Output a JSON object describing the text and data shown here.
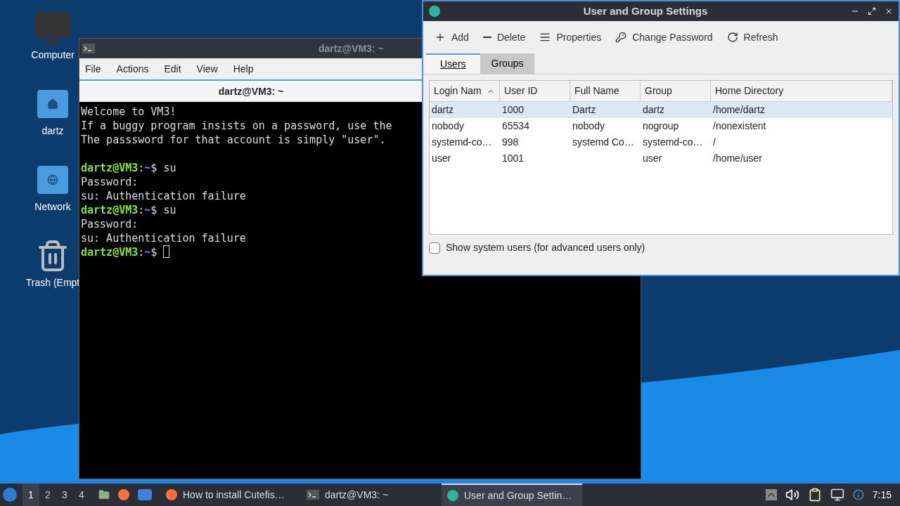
{
  "desktop_icons": [
    {
      "kind": "computer",
      "label": "Computer"
    },
    {
      "kind": "home",
      "label": "dartz"
    },
    {
      "kind": "network",
      "label": "Network"
    },
    {
      "kind": "trash",
      "label": "Trash (Empt"
    }
  ],
  "terminal": {
    "window_title": "dartz@VM3: ~",
    "menu": [
      "File",
      "Actions",
      "Edit",
      "View",
      "Help"
    ],
    "tab_title": "dartz@VM3: ~",
    "lines": [
      {
        "kind": "text",
        "text": "Welcome to VM3!"
      },
      {
        "kind": "text",
        "text": "If a buggy program insists on a password, use the"
      },
      {
        "kind": "text",
        "text": "The passsword for that account is simply \"user\"."
      },
      {
        "kind": "blank"
      },
      {
        "kind": "prompt",
        "user_host": "dartz@VM3",
        "separator": ":",
        "path": "~",
        "sign": "$",
        "command": "su"
      },
      {
        "kind": "text",
        "text": "Password:"
      },
      {
        "kind": "text",
        "text": "su: Authentication failure"
      },
      {
        "kind": "prompt",
        "user_host": "dartz@VM3",
        "separator": ":",
        "path": "~",
        "sign": "$",
        "command": "su"
      },
      {
        "kind": "text",
        "text": "Password:"
      },
      {
        "kind": "text",
        "text": "su: Authentication failure"
      },
      {
        "kind": "prompt",
        "user_host": "dartz@VM3",
        "separator": ":",
        "path": "~",
        "sign": "$",
        "cursor": true
      }
    ]
  },
  "settings": {
    "window_title": "User and Group Settings",
    "toolbar": [
      {
        "kind": "add",
        "label": "Add"
      },
      {
        "kind": "delete",
        "label": "Delete"
      },
      {
        "kind": "properties",
        "label": "Properties"
      },
      {
        "kind": "password",
        "label": "Change Password"
      },
      {
        "kind": "refresh",
        "label": "Refresh"
      }
    ],
    "tabs": [
      {
        "label": "Users",
        "selected": true
      },
      {
        "label": "Groups",
        "selected": false
      }
    ],
    "columns": [
      {
        "label": "Login Nam",
        "sorted": true
      },
      {
        "label": "User ID",
        "sorted": false
      },
      {
        "label": "Full Name",
        "sorted": false
      },
      {
        "label": "Group",
        "sorted": false
      },
      {
        "label": "Home Directory",
        "sorted": false
      }
    ],
    "rows": [
      {
        "cells": [
          "dartz",
          "1000",
          "Dartz",
          "dartz",
          "/home/dartz"
        ],
        "selected": true
      },
      {
        "cells": [
          "nobody",
          "65534",
          "nobody",
          "nogroup",
          "/nonexistent"
        ],
        "selected": false
      },
      {
        "cells": [
          "systemd-co…",
          "998",
          "systemd Co…",
          "systemd-co…",
          "/"
        ],
        "selected": false
      },
      {
        "cells": [
          "user",
          "1001",
          "",
          "user",
          "/home/user"
        ],
        "selected": false
      }
    ],
    "show_system_users": {
      "label": "Show system users (for advanced users only)",
      "checked": false
    }
  },
  "taskbar": {
    "workspaces": [
      {
        "label": "1",
        "selected": true
      },
      {
        "label": "2",
        "selected": false
      },
      {
        "label": "3",
        "selected": false
      },
      {
        "label": "4",
        "selected": false
      }
    ],
    "launchers": [
      {
        "kind": "files"
      },
      {
        "kind": "firefox"
      },
      {
        "kind": "desktop"
      }
    ],
    "tasks": [
      {
        "kind": "firefox",
        "label": "How to install Cutefis…",
        "selected": false
      },
      {
        "kind": "terminal",
        "label": "dartz@VM3: ~",
        "selected": false
      },
      {
        "kind": "settings",
        "label": "User and Group Settin…",
        "selected": true
      }
    ],
    "clock": "7:15"
  }
}
